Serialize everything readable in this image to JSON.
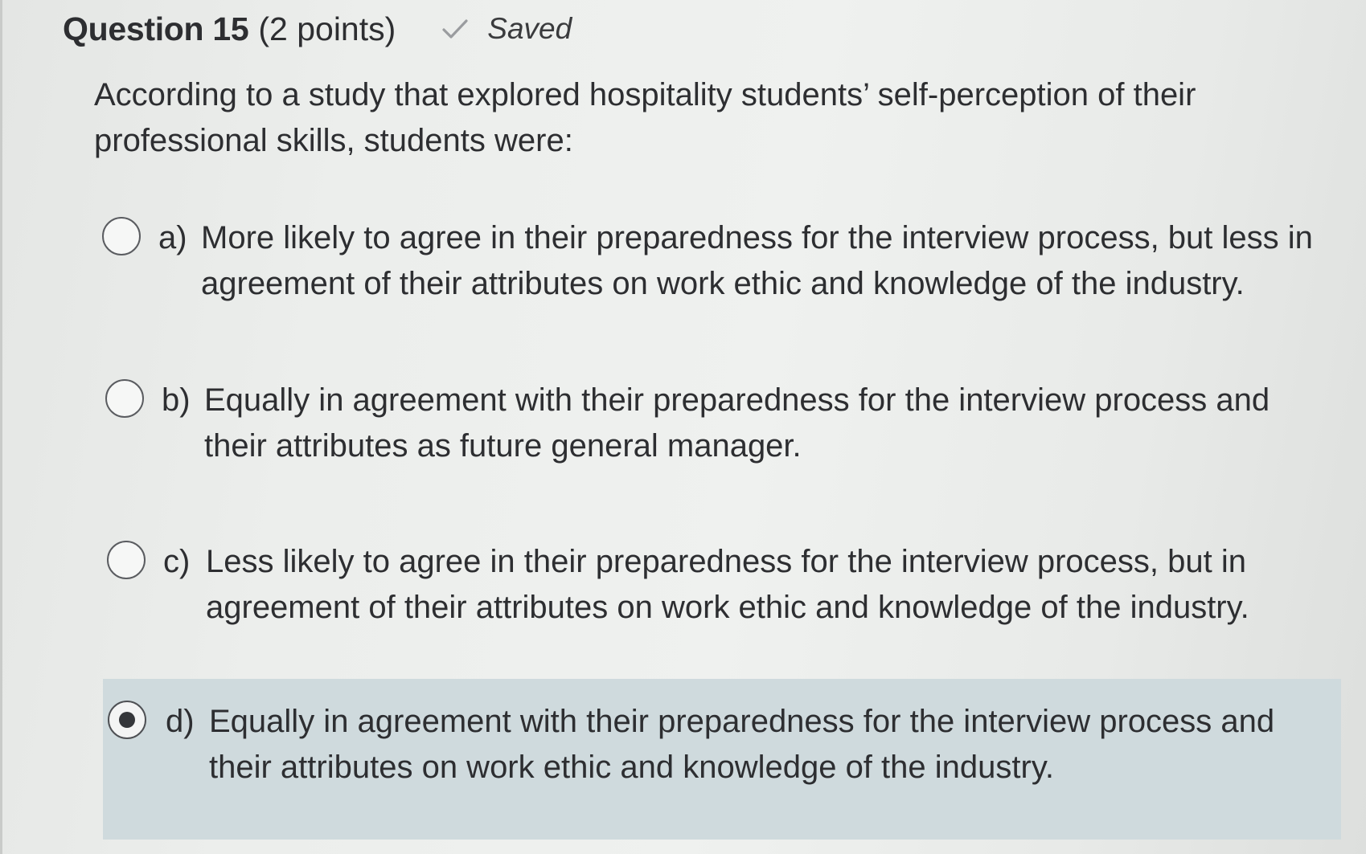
{
  "question": {
    "title": "Question 15",
    "points": "(2 points)",
    "status_icon": "check-icon",
    "status": "Saved",
    "text": "According to a study that explored hospitality students’ self-perception of their professional skills, students were:"
  },
  "options": [
    {
      "letter": "a)",
      "text": "More likely to agree in their preparedness for the interview process, but less in agreement of their attributes on work ethic and knowledge of the industry.",
      "selected": false
    },
    {
      "letter": "b)",
      "text": "Equally in agreement with their preparedness for the interview process and their attributes as future general manager.",
      "selected": false
    },
    {
      "letter": "c)",
      "text": "Less likely to agree in their preparedness for the interview process, but in agreement of their attributes on work ethic and knowledge of the industry.",
      "selected": false
    },
    {
      "letter": "d)",
      "text": "Equally in agreement with their preparedness for the interview process and their attributes on work ethic and knowledge of the industry.",
      "selected": true
    }
  ],
  "colors": {
    "selected_background": "#cfdadd",
    "text": "#2d2e31"
  }
}
